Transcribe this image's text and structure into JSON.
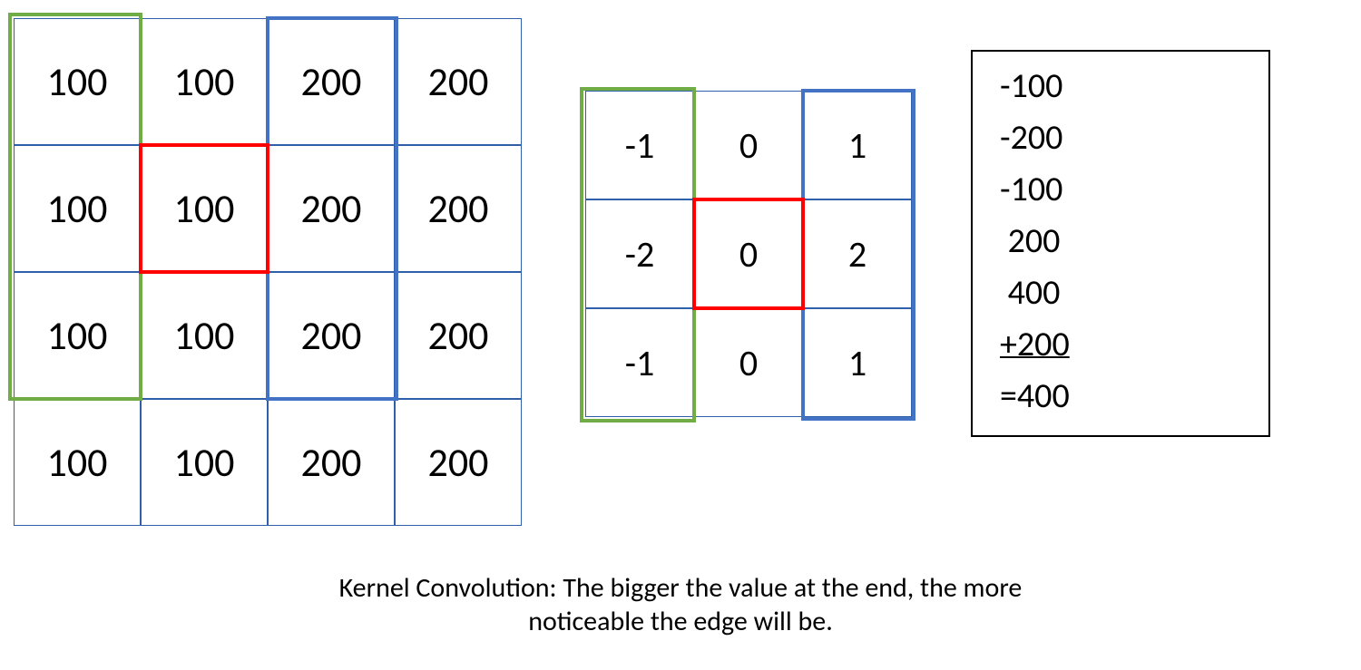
{
  "image_grid": {
    "rows": [
      [
        "100",
        "100",
        "200",
        "200"
      ],
      [
        "100",
        "100",
        "200",
        "200"
      ],
      [
        "100",
        "100",
        "200",
        "200"
      ],
      [
        "100",
        "100",
        "200",
        "200"
      ]
    ]
  },
  "kernel_grid": {
    "rows": [
      [
        "-1",
        "0",
        "1"
      ],
      [
        "-2",
        "0",
        "2"
      ],
      [
        "-1",
        "0",
        "1"
      ]
    ]
  },
  "calculation": {
    "lines": [
      "-100",
      "-200",
      "-100",
      " 200",
      " 400"
    ],
    "last_add": "+200",
    "result": "=400"
  },
  "caption_line1": "Kernel Convolution: The bigger the value at the end, the more",
  "caption_line2": "noticeable the edge will be."
}
